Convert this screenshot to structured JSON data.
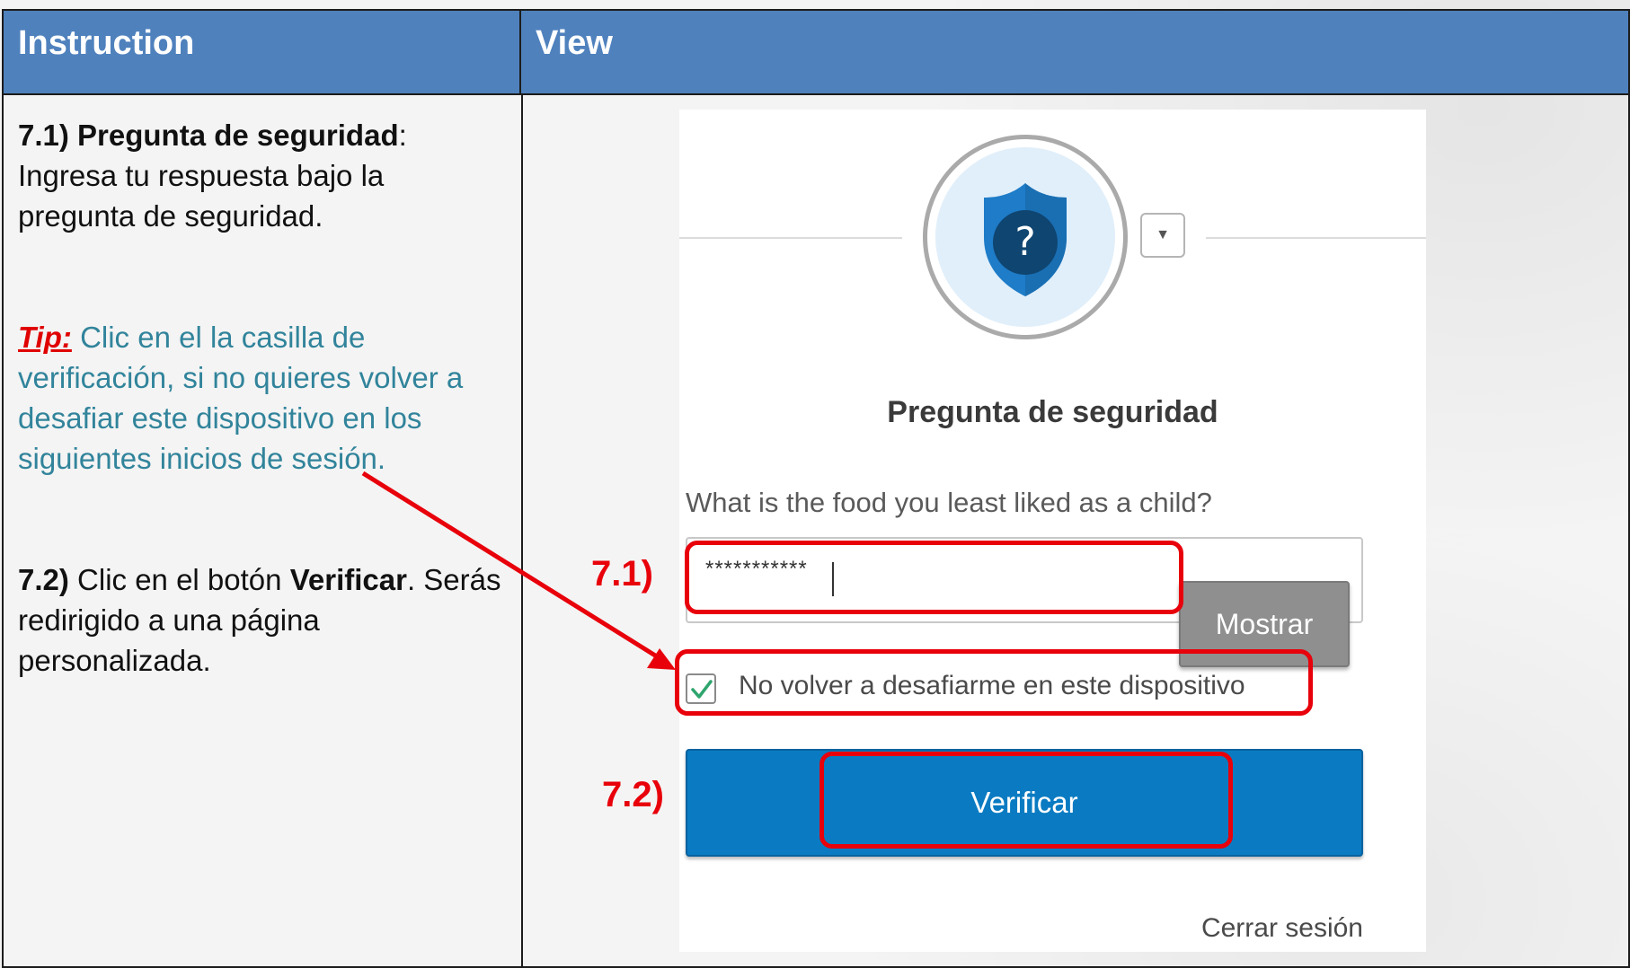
{
  "header": {
    "instruction_label": "Instruction",
    "view_label": "View"
  },
  "instructions": {
    "step1_title": "7.1) Pregunta de seguridad",
    "step1_colon": ":",
    "step1_text": "Ingresa tu respuesta bajo la pregunta de seguridad.",
    "tip_label": "Tip:",
    "tip_text": "Clic en el la casilla de verificación, si no quieres volver a desafiar este dispositivo en los siguientes inicios de sesión.",
    "step2_number": "7.2)",
    "step2_text_before": " Clic en el botón ",
    "step2_button_name": "Verificar",
    "step2_text_after": ". Serás redirigido a una página personalizada."
  },
  "card": {
    "icon": "shield-question-icon",
    "dropdown_icon": "chevron-down-icon",
    "dropdown_glyph": "▼",
    "title": "Pregunta de seguridad",
    "question": "What is the food you least liked as a child?",
    "answer_value": "***********",
    "show_button_label": "Mostrar",
    "remember_checkbox_label": "No volver a desafiarme en este dispositivo",
    "remember_checked": true,
    "verify_button_label": "Verificar",
    "signout_label": "Cerrar sesión"
  },
  "annotations": {
    "step1_label": "7.1)",
    "step2_label": "7.2)",
    "highlight_color": "#e8000b"
  },
  "colors": {
    "header_bg": "#4f81bd",
    "tip_text": "#31849b",
    "tip_label": "#e00000",
    "verify_button": "#0a7bc2",
    "show_button": "#8f8f8f",
    "icon_bg": "#e1effa",
    "shield": "#1e7cc8"
  }
}
